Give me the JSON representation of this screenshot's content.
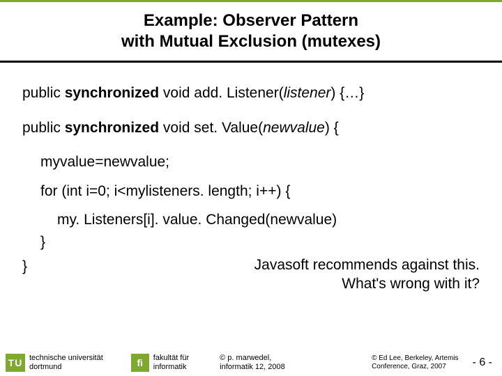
{
  "title": {
    "line1": "Example: Observer Pattern",
    "line2": "with Mutual Exclusion (mutexes)"
  },
  "code": {
    "line1_pre": "public ",
    "line1_kw": "synchronized",
    "line1_mid": " void add. Listener(",
    "line1_arg": "listener",
    "line1_post": ") {…}",
    "line2_pre": "public ",
    "line2_kw": "synchronized",
    "line2_mid": " void set. Value(",
    "line2_arg": "newvalue",
    "line2_post": ") {",
    "line3": "myvalue=newvalue;",
    "line4": "for (int i=0; i<mylisteners. length; i++) {",
    "line5": "my. Listeners[i]. value. Changed(newvalue)",
    "line6": "}",
    "line7": "}"
  },
  "commentary": {
    "l1": "Javasoft recommends against this.",
    "l2": "What's wrong with it?"
  },
  "footer": {
    "tu_mark": "TU",
    "tu_line1": "technische universität",
    "tu_line2": "dortmund",
    "fi_mark": "fi",
    "fi_line1": "fakultät für",
    "fi_line2": "informatik",
    "center_l1": "© p. marwedel,",
    "center_l2": "informatik 12,  2008",
    "right_l1": "© Ed Lee, Berkeley, Artemis",
    "right_l2": "Conference, Graz, 2007",
    "page": "- 6 -"
  }
}
